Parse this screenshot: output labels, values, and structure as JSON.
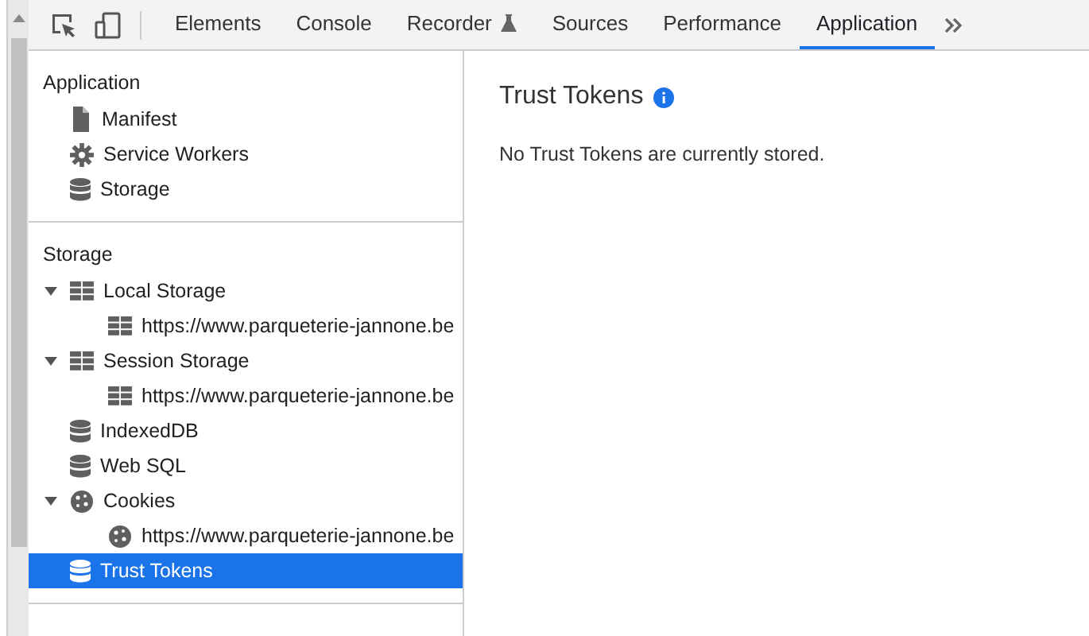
{
  "tabs": [
    {
      "label": "Elements",
      "kind": "plain",
      "selected": false
    },
    {
      "label": "Console",
      "kind": "plain",
      "selected": false
    },
    {
      "label": "Recorder",
      "kind": "experimental",
      "selected": false
    },
    {
      "label": "Sources",
      "kind": "plain",
      "selected": false
    },
    {
      "label": "Performance",
      "kind": "plain",
      "selected": false
    },
    {
      "label": "Application",
      "kind": "plain",
      "selected": true
    }
  ],
  "sidebar": {
    "sections": [
      {
        "title": "Application",
        "items": [
          {
            "label": "Manifest",
            "kind": "file",
            "selected": false
          },
          {
            "label": "Service Workers",
            "kind": "gear",
            "selected": false
          },
          {
            "label": "Storage",
            "kind": "database",
            "selected": false
          }
        ]
      },
      {
        "title": "Storage",
        "items": [
          {
            "label": "Local Storage",
            "kind": "table",
            "selected": false,
            "expanded": true,
            "children": [
              {
                "label": "https://www.parqueterie-jannone.be",
                "kind": "table",
                "selected": false
              }
            ]
          },
          {
            "label": "Session Storage",
            "kind": "table",
            "selected": false,
            "expanded": true,
            "children": [
              {
                "label": "https://www.parqueterie-jannone.be",
                "kind": "table",
                "selected": false
              }
            ]
          },
          {
            "label": "IndexedDB",
            "kind": "database",
            "selected": false
          },
          {
            "label": "Web SQL",
            "kind": "database",
            "selected": false
          },
          {
            "label": "Cookies",
            "kind": "cookie",
            "selected": false,
            "expanded": true,
            "children": [
              {
                "label": "https://www.parqueterie-jannone.be",
                "kind": "cookie",
                "selected": false
              }
            ]
          },
          {
            "label": "Trust Tokens",
            "kind": "database",
            "selected": true
          }
        ]
      }
    ]
  },
  "main": {
    "title": "Trust Tokens",
    "message": "No Trust Tokens are currently stored."
  }
}
